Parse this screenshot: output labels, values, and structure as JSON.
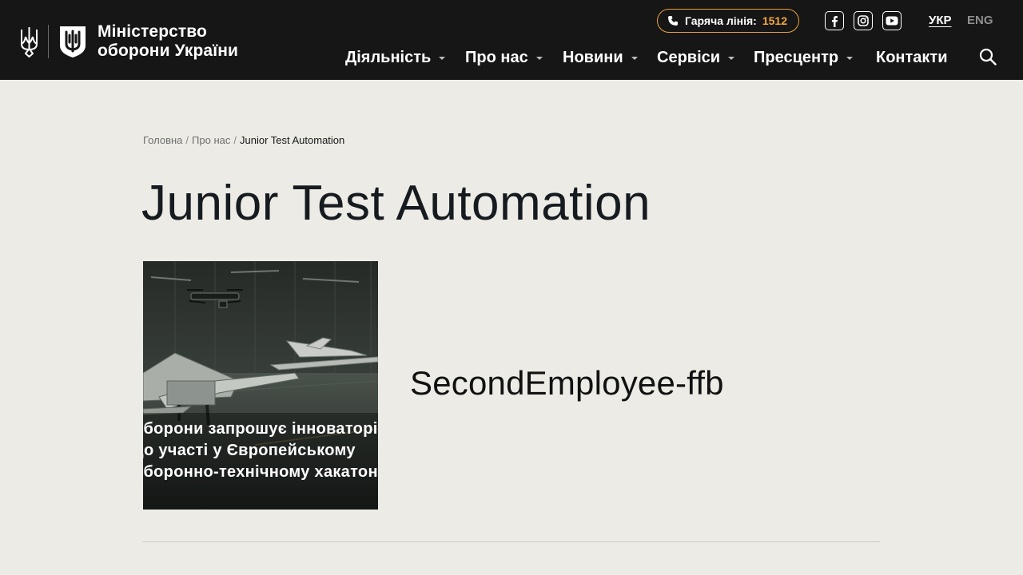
{
  "header": {
    "logo": {
      "line1": "Міністерство",
      "line2": "оборони України",
      "trident_icon": "trident-icon",
      "emblem_icon": "shield-emblem-icon"
    },
    "hotline": {
      "label": "Гаряча лінія:",
      "number": "1512",
      "icon": "phone-icon"
    },
    "social": [
      {
        "name": "facebook",
        "icon": "facebook-icon"
      },
      {
        "name": "instagram",
        "icon": "instagram-icon"
      },
      {
        "name": "youtube",
        "icon": "youtube-icon"
      }
    ],
    "languages": [
      {
        "label": "УКР",
        "active": true
      },
      {
        "label": "ENG",
        "active": false
      }
    ],
    "nav": [
      {
        "label": "Діяльність",
        "has_dropdown": true
      },
      {
        "label": "Про нас",
        "has_dropdown": true
      },
      {
        "label": "Новини",
        "has_dropdown": true
      },
      {
        "label": "Сервіси",
        "has_dropdown": true
      },
      {
        "label": "Пресцентр",
        "has_dropdown": true
      },
      {
        "label": "Контакти",
        "has_dropdown": false
      }
    ],
    "search_icon": "search-icon"
  },
  "breadcrumb": {
    "items": [
      "Головна",
      "Про нас"
    ],
    "separator": "/",
    "current": "Junior Test Automation"
  },
  "page": {
    "title": "Junior Test Automation",
    "hero_image": {
      "caption_lines": [
        "оборони запрошує інноваторів",
        "до участі у Європейському",
        "оборонно-технічному хакатоні"
      ]
    },
    "employee_name": "SecondEmployee-ffb"
  },
  "colors": {
    "header_bg": "#161616",
    "page_bg": "#ecebe6",
    "accent": "#f2a93b"
  }
}
